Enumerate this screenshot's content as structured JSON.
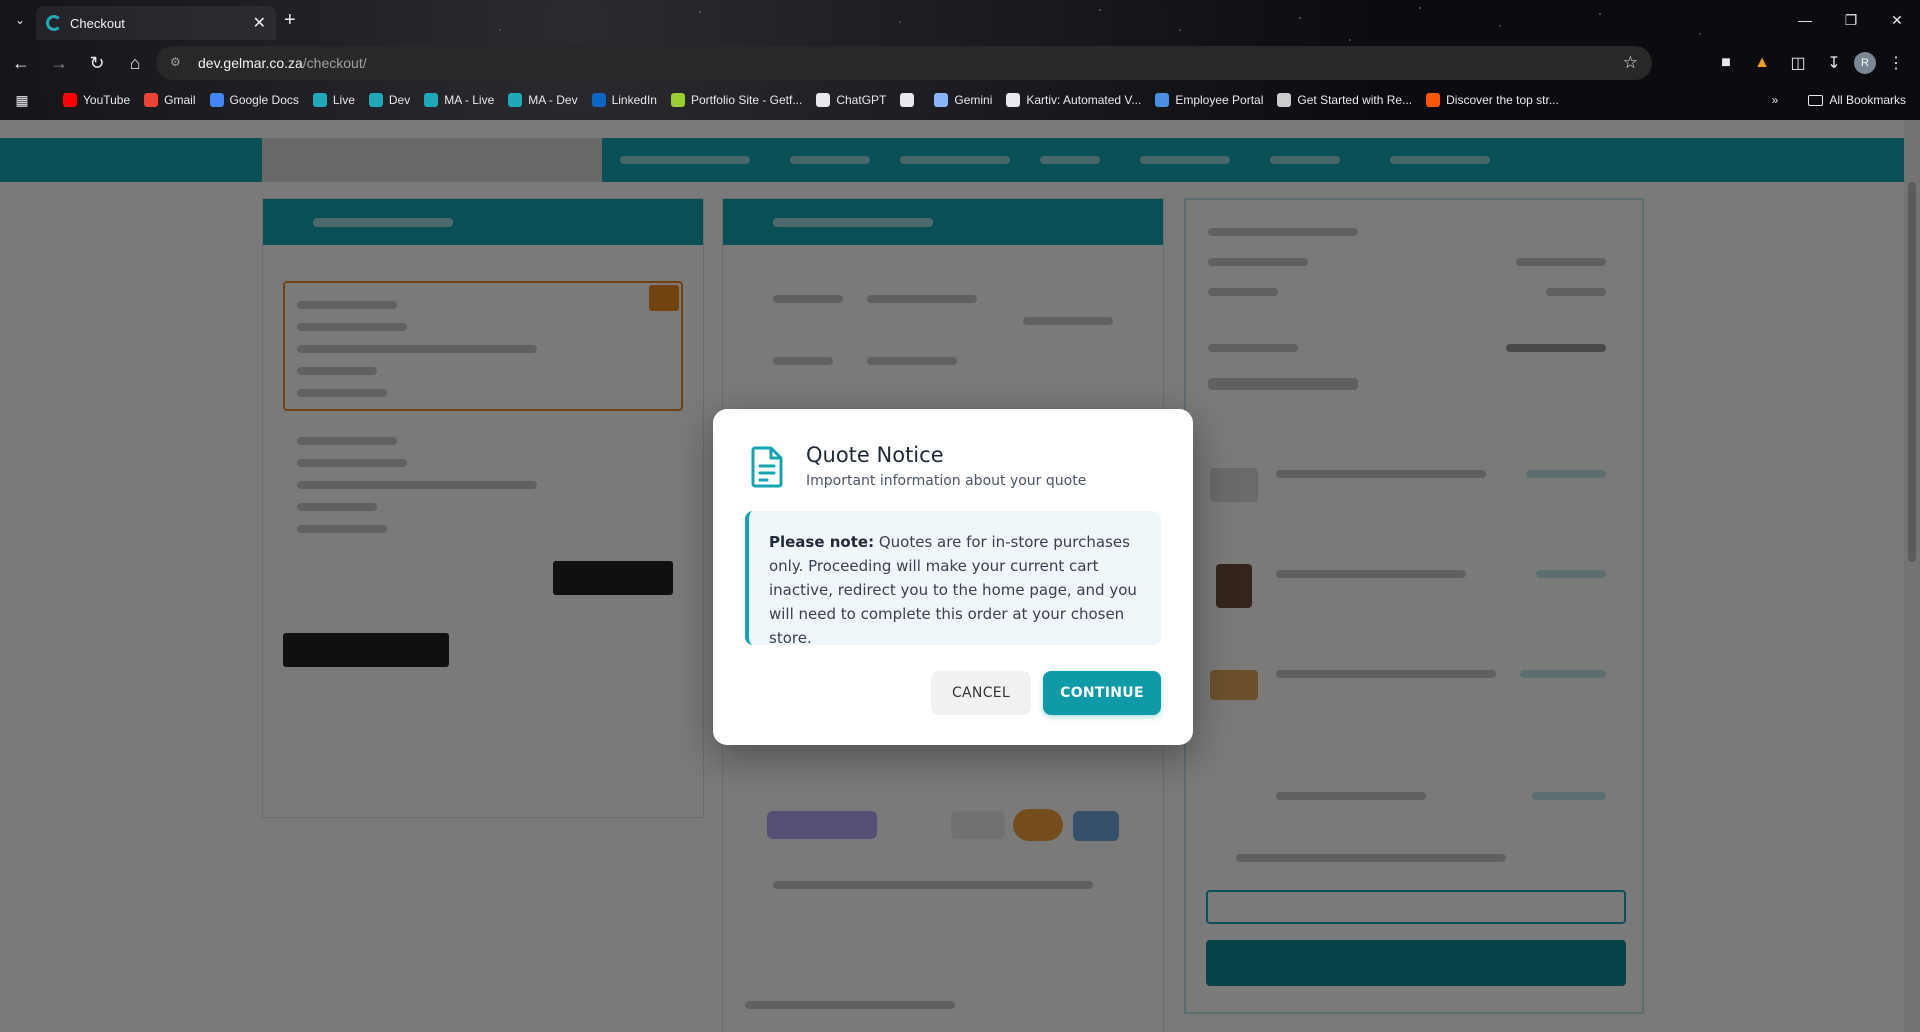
{
  "browser": {
    "tab_title": "Checkout",
    "url_host": "dev.gelmar.co.za",
    "url_path": "/checkout/",
    "bookmarks": [
      {
        "label": "YouTube",
        "color": "#ff0000"
      },
      {
        "label": "Gmail",
        "color": "#ea4335"
      },
      {
        "label": "Google Docs",
        "color": "#4285f4"
      },
      {
        "label": "Live",
        "color": "#1fa9b8"
      },
      {
        "label": "Dev",
        "color": "#1fa9b8"
      },
      {
        "label": "MA - Live",
        "color": "#1fa9b8"
      },
      {
        "label": "MA - Dev",
        "color": "#1fa9b8"
      },
      {
        "label": "LinkedIn",
        "color": "#0a66c2"
      },
      {
        "label": "Portfolio Site - Getf...",
        "color": "#9acd32"
      },
      {
        "label": "ChatGPT",
        "color": "#e8eaed"
      },
      {
        "label": "",
        "color": "#e8eaed"
      },
      {
        "label": "Gemini",
        "color": "#8ab4f8"
      },
      {
        "label": "Kartiv: Automated V...",
        "color": "#e8eaed"
      },
      {
        "label": "Employee Portal",
        "color": "#4a90e2"
      },
      {
        "label": "Get Started with Re...",
        "color": "#cccccc"
      },
      {
        "label": "Discover the top str...",
        "color": "#ff5500"
      }
    ],
    "all_bookmarks_label": "All Bookmarks",
    "avatar_letter": "R"
  },
  "modal": {
    "title": "Quote Notice",
    "subtitle": "Important information about your quote",
    "notice_bold": "Please note:",
    "notice_text": " Quotes are for in-store purchases only. Proceeding will make your current cart inactive, redirect you to the home page, and you will need to complete this order at your chosen store.",
    "cancel_label": "CANCEL",
    "continue_label": "CONTINUE"
  },
  "colors": {
    "brand_teal": "#14a5b3",
    "button_teal": "#0e9aa7",
    "accent_orange": "#f08a24"
  }
}
